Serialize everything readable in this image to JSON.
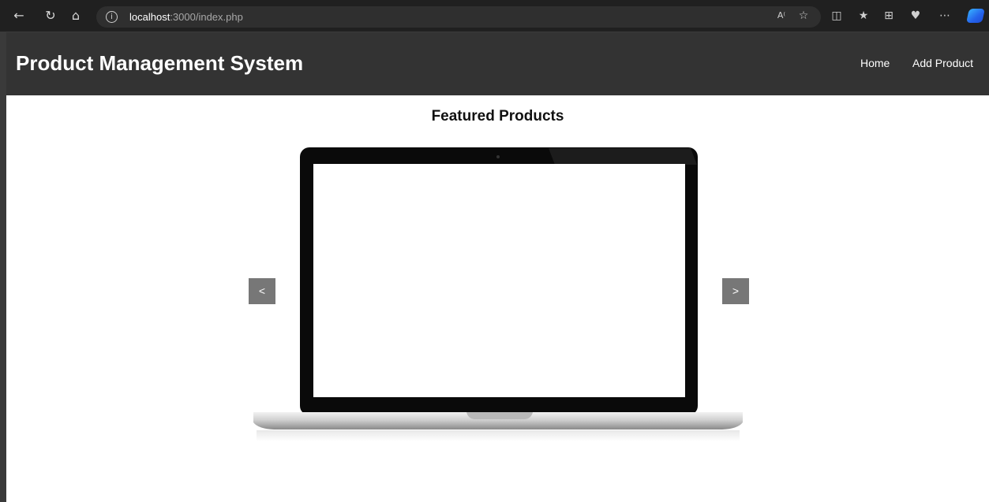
{
  "browser": {
    "url_host": "localhost",
    "url_path": ":3000/index.php",
    "icons": [
      "back-icon",
      "refresh-icon",
      "home-icon",
      "info-icon",
      "read-aloud-icon",
      "favorite-star-icon",
      "split-screen-icon",
      "favorites-icon",
      "collections-icon",
      "health-icon",
      "more-icon",
      "copilot-icon"
    ]
  },
  "navbar": {
    "title": "Product Management System",
    "links": [
      {
        "label": "Home"
      },
      {
        "label": "Add Product"
      }
    ]
  },
  "featured": {
    "title": "Featured Products",
    "prev_label": "<",
    "next_label": ">",
    "image": "laptop-image"
  },
  "colors": {
    "navbar_bg": "#333333",
    "browser_bg": "#202020",
    "slider_button_bg": "#777777"
  }
}
